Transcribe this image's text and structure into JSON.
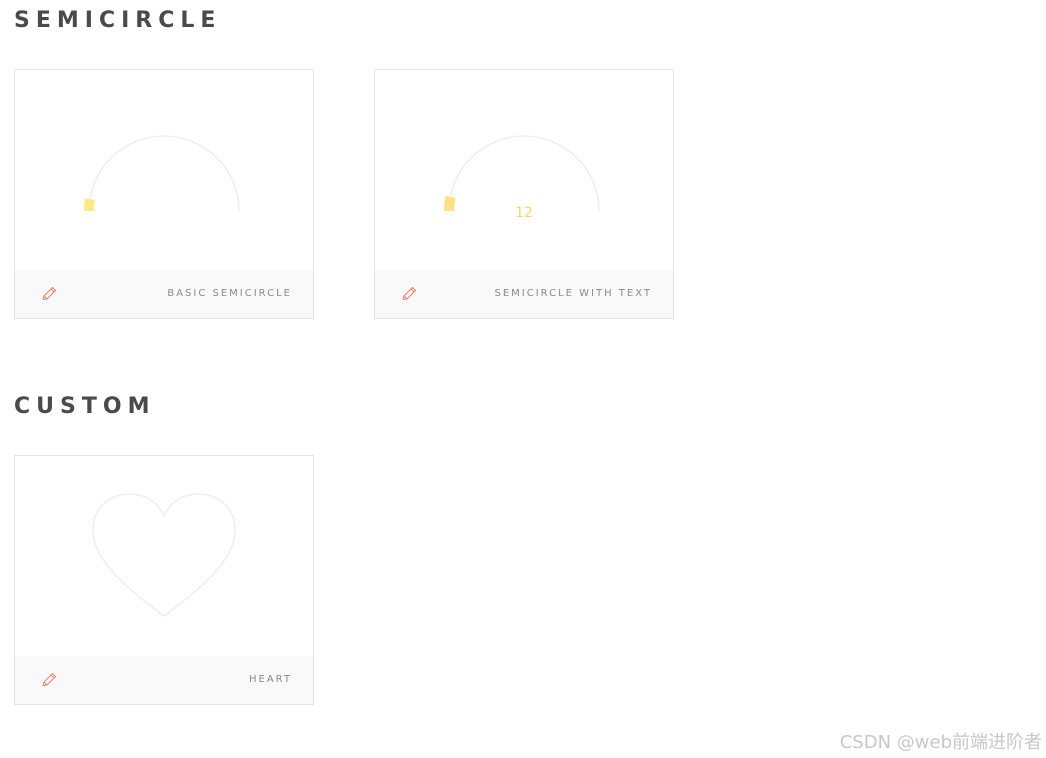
{
  "sections": [
    {
      "title": "SEMICIRCLE",
      "cards": [
        {
          "label": "BASIC SEMICIRCLE",
          "edit_icon": "pencil-icon",
          "progress": 0.05,
          "show_text": false,
          "stroke_color": "#FFEA82"
        },
        {
          "label": "SEMICIRCLE WITH TEXT",
          "edit_icon": "pencil-icon",
          "progress": 0.06,
          "show_text": true,
          "text": "12",
          "stroke_color": "#FFE082"
        }
      ]
    },
    {
      "title": "CUSTOM",
      "cards": [
        {
          "label": "HEART",
          "edit_icon": "pencil-icon",
          "progress": 0,
          "shape": "heart"
        }
      ]
    }
  ],
  "colors": {
    "trail": "#EEEEEE",
    "semicircle_fill": "#FFEA82",
    "semicircle_text_fill": "#FFE082",
    "value_text": "#F7D566",
    "edit_icon": "#E57F6B",
    "title": "#4A4A4A",
    "label": "#8A8A8A",
    "footer_bg": "#F9F9F9",
    "card_border": "#E3E3E3"
  },
  "watermark": "CSDN @web前端进阶者"
}
